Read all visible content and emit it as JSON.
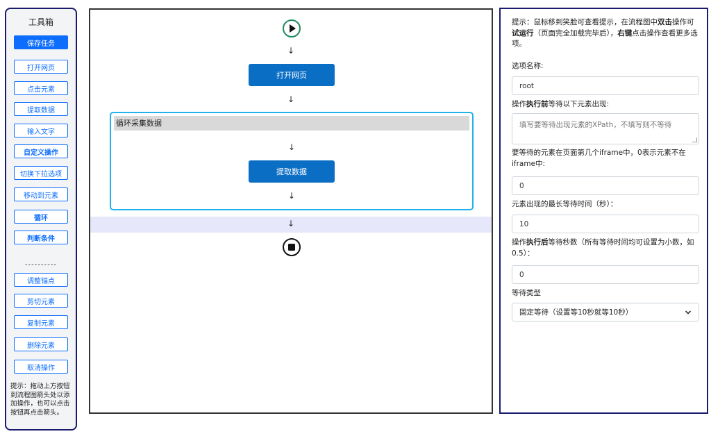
{
  "toolbox": {
    "title": "工具箱",
    "buttons": [
      {
        "label": "保存任务"
      },
      {
        "label": "打开网页"
      },
      {
        "label": "点击元素"
      },
      {
        "label": "提取数据"
      },
      {
        "label": "输入文字"
      },
      {
        "label": "自定义操作"
      },
      {
        "label": "切换下拉选项"
      },
      {
        "label": "移动到元素"
      },
      {
        "label": "循环"
      },
      {
        "label": "判断条件"
      }
    ],
    "separator": "----------",
    "buttons2": [
      {
        "label": "调整锚点"
      },
      {
        "label": "剪切元素"
      },
      {
        "label": "复制元素"
      },
      {
        "label": "删除元素"
      },
      {
        "label": "取消操作"
      }
    ],
    "hint": "提示：拖动上方按钮到流程图箭头处以添加操作，也可以点击按钮再点击箭头。"
  },
  "flow": {
    "arrow": "↓",
    "node_open": "打开网页",
    "loop_title": "循环采集数据",
    "node_extract": "提取数据"
  },
  "panel": {
    "hint_parts": [
      "提示：鼠标移到笑脸可查看提示，在流程图中",
      "双击",
      "操作可",
      "试运行",
      "（页面完全加载完毕后），",
      "右键",
      "点击操作查看更多选项。"
    ],
    "name_label": "选项名称:",
    "name_value": "root",
    "wait_label_prefix": "操作",
    "wait_label_bold": "执行前",
    "wait_label_suffix": "等待以下元素出现:",
    "xpath_placeholder": "填写要等待出现元素的XPath，不填写则不等待",
    "iframe_label": "要等待的元素在页面第几个iframe中，0表示元素不在iframe中:",
    "iframe_value": "0",
    "maxwait_label": "元素出现的最长等待时间（秒）：",
    "maxwait_value": "10",
    "after_label_prefix": "操作",
    "after_label_bold": "执行后",
    "after_label_suffix": "等待秒数（所有等待时间均可设置为小数，如0.5）：",
    "after_value": "0",
    "waittype_label": "等待类型",
    "waittype_selected": "固定等待（设置等10秒就等10秒）"
  },
  "colors": {
    "primary": "#0d6efd",
    "node": "#0b6ec5",
    "loop_border": "#20b2e8",
    "start_icon": "#1f8a5c"
  }
}
